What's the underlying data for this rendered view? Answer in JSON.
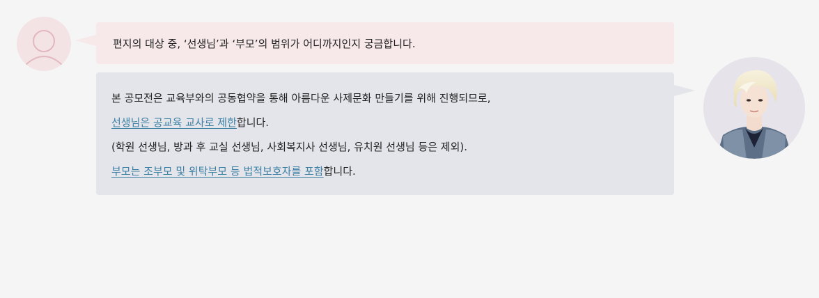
{
  "question": {
    "text": "편지의 대상 중, ‘선생님’과 ‘부모’의 범위가 어디까지인지 궁금합니다."
  },
  "answer": {
    "line1": "본 공모전은 교육부와의 공동협약을 통해 아름다운 사제문화 만들기를 위해 진행되므로,",
    "line2_highlight": "선생님은 공교육 교사로 제한",
    "line2_tail": "합니다.",
    "line3": "(학원 선생님, 방과 후 교실 선생님, 사회복지사 선생님, 유치원 선생님 등은 제외).",
    "line4_highlight": "부모는 조부모 및 위탁부모 등 법적보호자를 포함",
    "line4_tail": "합니다."
  },
  "colors": {
    "page_background": "#f5f5f5",
    "question_bubble": "#f7e8ea",
    "answer_bubble": "#e4e5ea",
    "highlight_text": "#3b7fa3",
    "user_avatar_bg": "#f3e3e5",
    "user_avatar_stroke": "#e2b7bd"
  },
  "icons": {
    "user_avatar": "user-outline-icon",
    "answerer_avatar": "answerer-portrait"
  }
}
